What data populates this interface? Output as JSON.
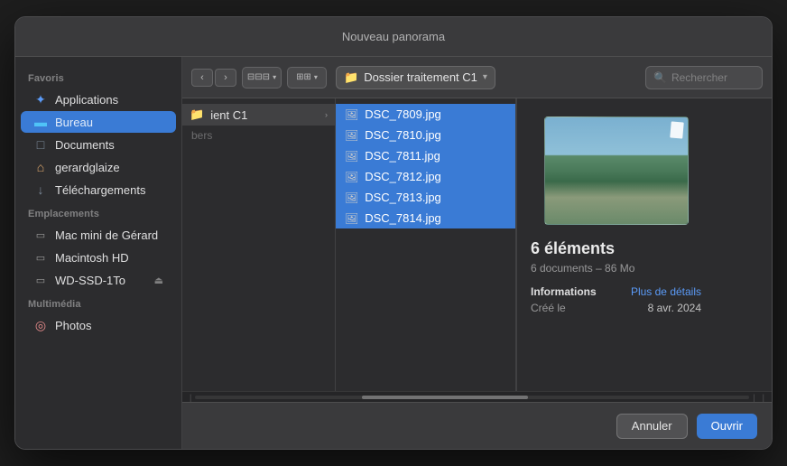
{
  "titleBar": {
    "text": "Nouveau panorama"
  },
  "toolbar": {
    "location": "Dossier traitement C1",
    "searchPlaceholder": "Rechercher"
  },
  "sidebar": {
    "sections": [
      {
        "label": "Favoris",
        "items": [
          {
            "id": "applications",
            "icon": "✦",
            "iconClass": "icon-app",
            "label": "Applications",
            "active": false
          },
          {
            "id": "bureau",
            "icon": "▬",
            "iconClass": "icon-bureau",
            "label": "Bureau",
            "active": true
          },
          {
            "id": "documents",
            "icon": "□",
            "iconClass": "icon-docs",
            "label": "Documents",
            "active": false
          },
          {
            "id": "gerardglaize",
            "icon": "⌂",
            "iconClass": "icon-home",
            "label": "gerardglaize",
            "active": false
          },
          {
            "id": "telechargements",
            "icon": "↓",
            "iconClass": "icon-dl",
            "label": "Téléchargements",
            "active": false
          }
        ]
      },
      {
        "label": "Emplacements",
        "items": [
          {
            "id": "mac-mini",
            "icon": "▭",
            "iconClass": "icon-mac-mini",
            "label": "Mac mini de Gérard",
            "active": false
          },
          {
            "id": "macintosh-hd",
            "icon": "▭",
            "iconClass": "icon-hd",
            "label": "Macintosh HD",
            "active": false
          },
          {
            "id": "wd-ssd",
            "icon": "▭",
            "iconClass": "icon-wd",
            "label": "WD-SSD-1To",
            "active": false
          }
        ]
      },
      {
        "label": "Multimédia",
        "items": [
          {
            "id": "photos",
            "icon": "◎",
            "iconClass": "icon-photos",
            "label": "Photos",
            "active": false
          }
        ]
      }
    ]
  },
  "columnView": {
    "leftColumn": {
      "items": [
        {
          "label": "ient C1",
          "hasChevron": true,
          "active": true
        }
      ]
    },
    "middleColumn": {
      "items": [
        {
          "label": "DSC_7809.jpg",
          "selected": true
        },
        {
          "label": "DSC_7810.jpg",
          "selected": true
        },
        {
          "label": "DSC_7811.jpg",
          "selected": true
        },
        {
          "label": "DSC_7812.jpg",
          "selected": true
        },
        {
          "label": "DSC_7813.jpg",
          "selected": true
        },
        {
          "label": "DSC_7814.jpg",
          "selected": true
        }
      ]
    }
  },
  "preview": {
    "count": "6 éléments",
    "sub": "6 documents – 86 Mo",
    "infoLabel": "Informations",
    "infoLink": "Plus de détails",
    "dateLabel": "Créé le",
    "dateValue": "8 avr. 2024"
  },
  "bottomBar": {
    "cancelLabel": "Annuler",
    "openLabel": "Ouvrir"
  }
}
